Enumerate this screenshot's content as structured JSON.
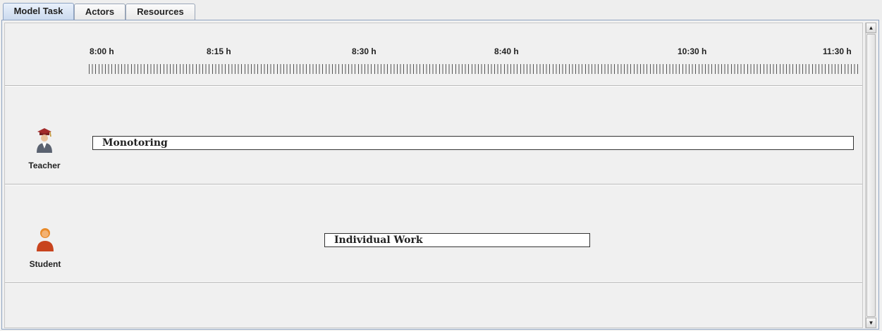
{
  "tabs": [
    {
      "label": "Model Task",
      "active": true
    },
    {
      "label": "Actors",
      "active": false
    },
    {
      "label": "Resources",
      "active": false
    }
  ],
  "timeline": {
    "ticks": [
      "8:00 h",
      "8:15 h",
      "8:30 h",
      "8:40 h",
      "10:30 h",
      "11:30 h"
    ]
  },
  "actors": [
    {
      "label": "Teacher",
      "icon": "teacher-icon"
    },
    {
      "label": "Student",
      "icon": "student-icon"
    }
  ],
  "tasks": [
    {
      "label": "Monotoring",
      "actor": "Teacher"
    },
    {
      "label": "Individual Work",
      "actor": "Student"
    }
  ],
  "scrollbar": {
    "up": "▲",
    "down": "▼"
  },
  "colors": {
    "tab_active": "#c9d9ee",
    "panel_border": "#8ea3c2",
    "background": "#f0f0f0",
    "task_fill": "#ffffff"
  }
}
